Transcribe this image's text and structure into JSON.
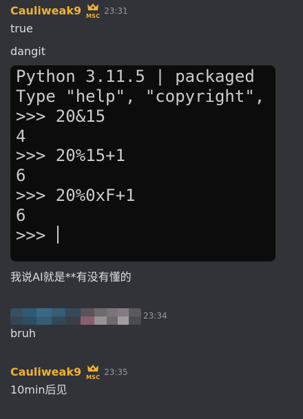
{
  "messages": [
    {
      "author": "Cauliweak9",
      "badge": "MSC",
      "time": "23:31",
      "lines": [
        "true",
        "dangit"
      ]
    },
    {
      "terminal": {
        "lines": [
          "Python 3.11.5 | packaged",
          "Type \"help\", \"copyright\",",
          ">>> 20&15",
          "4",
          ">>> 20%15+1",
          "6",
          ">>> 20%0xF+1",
          "6",
          ">>> "
        ]
      }
    },
    {
      "lines": [
        "我说AI就是**有没有懂的"
      ]
    },
    {
      "author_redacted": true,
      "time": "23:34",
      "lines": [
        "bruh"
      ]
    },
    {
      "author": "Cauliweak9",
      "badge": "MSC",
      "time": "23:35",
      "lines": [
        "10min后见"
      ]
    }
  ],
  "colors": {
    "background": "#313338",
    "username": "#f0b232",
    "text": "#dbdee1",
    "timestamp": "#949ba4",
    "terminal_bg": "#0c0c0c",
    "terminal_text": "#cccccc"
  }
}
